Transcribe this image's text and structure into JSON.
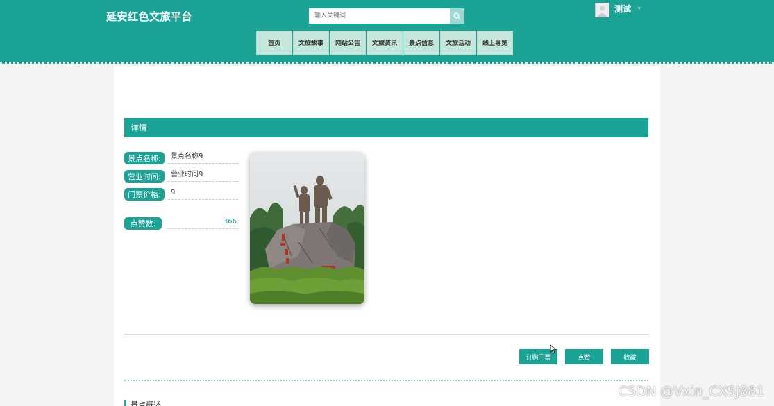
{
  "header": {
    "logo": "延安红色文旅平台",
    "search_placeholder": "输入关键词",
    "username": "测试",
    "caret": "▾"
  },
  "nav": {
    "items": [
      {
        "label": "首页"
      },
      {
        "label": "文旅故事"
      },
      {
        "label": "网站公告"
      },
      {
        "label": "文旅资讯"
      },
      {
        "label": "景点信息"
      },
      {
        "label": "文旅活动"
      },
      {
        "label": "线上导览"
      }
    ]
  },
  "detail": {
    "section_title": "详情",
    "fields": [
      {
        "label": "景点名称:",
        "value": "景点名称9"
      },
      {
        "label": "营业时间:",
        "value": "营业时间9"
      },
      {
        "label": "门票价格:",
        "value": "9"
      }
    ],
    "like_label": "点赞数:",
    "like_count": "366"
  },
  "actions": {
    "buy_ticket": "订购门票",
    "like": "点赞",
    "favorite": "收藏"
  },
  "overview_title": "景点概述",
  "watermark": "CSDN @Vxin_CXSJ881",
  "colors": {
    "primary": "#1ba395",
    "nav_bg": "#c4e6dc",
    "search_btn": "#9fd8d2"
  }
}
